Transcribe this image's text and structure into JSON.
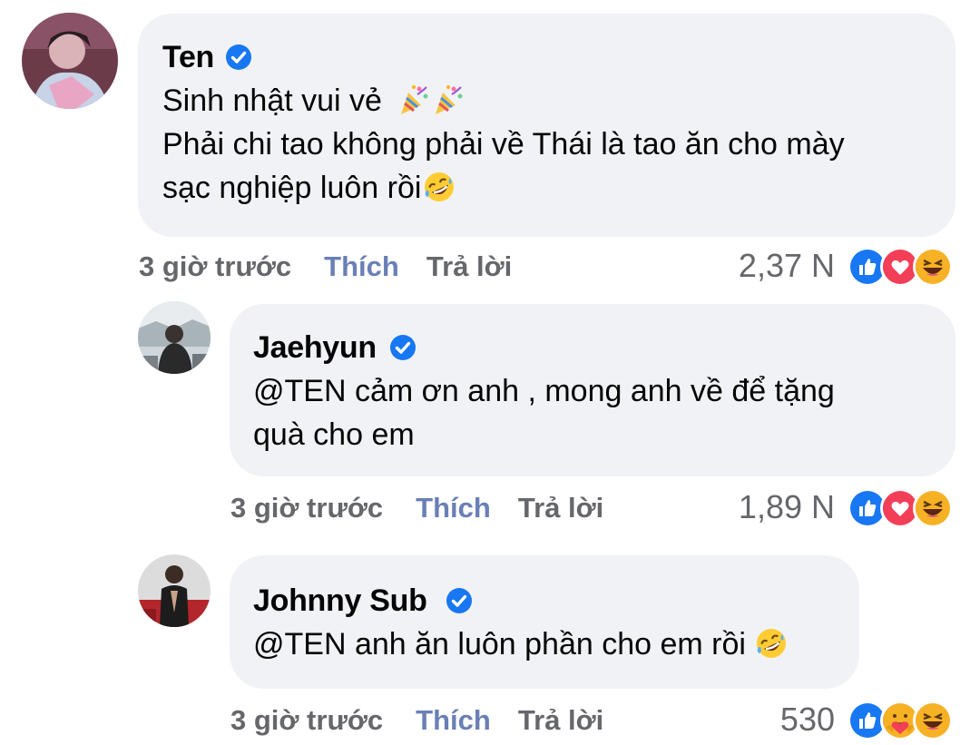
{
  "comments": [
    {
      "author": "Ten",
      "lines": [
        "Sinh nhật vui vẻ",
        "Phải chi tao không phải về Thái là tao ăn cho mày",
        "sạc nghiệp luôn rồi"
      ],
      "time": "3 giờ trước",
      "like_label": "Thích",
      "reply_label": "Trả lời",
      "reaction_count": "2,37 N",
      "reactions": [
        "like-icon",
        "love-icon",
        "haha-icon"
      ]
    },
    {
      "author": "Jaehyun",
      "lines": [
        "@TEN cảm ơn anh , mong anh về để tặng",
        "quà cho em"
      ],
      "time": "3 giờ trước",
      "like_label": "Thích",
      "reply_label": "Trả lời",
      "reaction_count": "1,89 N",
      "reactions": [
        "like-icon",
        "love-icon",
        "haha-icon"
      ]
    },
    {
      "author": "Johnny Sub",
      "lines": [
        "@TEN anh ăn luôn phần cho em rồi"
      ],
      "time": "3 giờ trước",
      "like_label": "Thích",
      "reply_label": "Trả lời",
      "reaction_count": "530",
      "reactions": [
        "like-icon",
        "care-icon",
        "haha-icon"
      ]
    }
  ],
  "colors": {
    "bubble": "#f0f2f5",
    "like_blue": "#1877f2",
    "muted": "#65676b",
    "like_text": "#6a7fb5"
  }
}
